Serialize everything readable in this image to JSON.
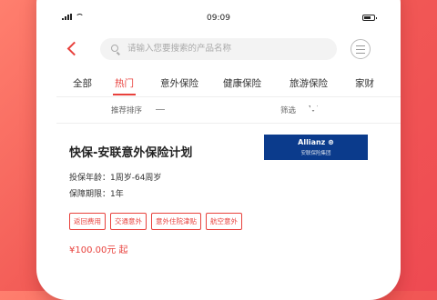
{
  "status_bar": {
    "time": "09:09"
  },
  "search": {
    "placeholder": "请输入您要搜索的产品名称"
  },
  "tabs": [
    {
      "label": "全部",
      "active": false
    },
    {
      "label": "热门",
      "active": true
    },
    {
      "label": "意外保险",
      "active": false
    },
    {
      "label": "健康保险",
      "active": false
    },
    {
      "label": "旅游保险",
      "active": false
    },
    {
      "label": "家财",
      "active": false
    }
  ],
  "sort_bar": {
    "sort_label": "推荐排序",
    "filter_label": "筛选"
  },
  "product": {
    "title": "快保-安联意外保险计划",
    "brand_name": "Allianz ⊛",
    "brand_sub": "安联保险集团",
    "age_range": "投保年龄：1周岁-64周岁",
    "period": "保障期限：1年",
    "tags": [
      "返回费用",
      "交通意外",
      "意外住院津贴",
      "航空意外"
    ],
    "price": "¥100.00元 起"
  },
  "colors": {
    "accent": "#e8413c",
    "brand_bg": "#0b3b8c"
  },
  "icons": [
    "back-icon",
    "search-icon",
    "filter-icon",
    "funnel-icon",
    "sort-arrow-icon"
  ]
}
